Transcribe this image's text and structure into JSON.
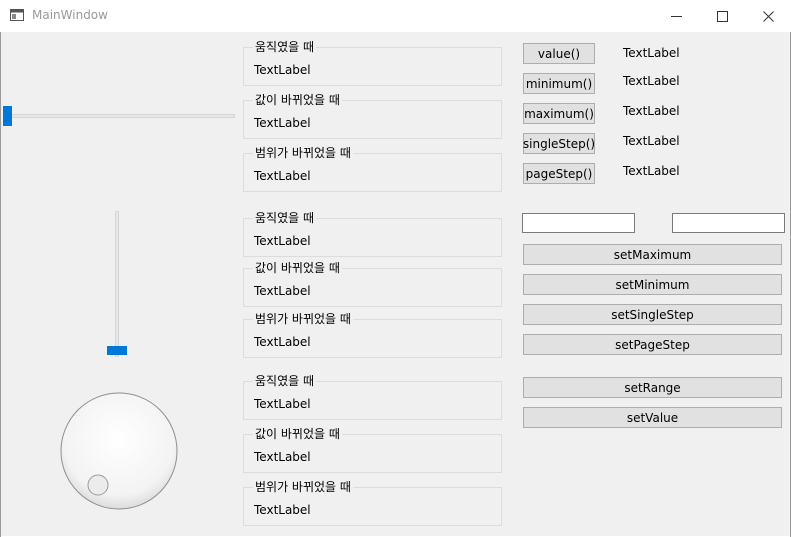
{
  "window": {
    "title": "MainWindow",
    "minimize_glyph": "—",
    "maximize_glyph": "☐",
    "close_glyph": "✕"
  },
  "slider_h": {
    "position_fraction": 0.0
  },
  "slider_v": {
    "position_fraction": 0.0
  },
  "dial": {
    "position_fraction": 0.0
  },
  "groups": [
    {
      "title": "움직였을 때",
      "label": "TextLabel"
    },
    {
      "title": "값이 바뀌었을 때",
      "label": "TextLabel"
    },
    {
      "title": "범위가 바뀌었을 때",
      "label": "TextLabel"
    },
    {
      "title": "움직였을 때",
      "label": "TextLabel"
    },
    {
      "title": "값이 바뀌었을 때",
      "label": "TextLabel"
    },
    {
      "title": "범위가 바뀌었을 때",
      "label": "TextLabel"
    },
    {
      "title": "움직였을 때",
      "label": "TextLabel"
    },
    {
      "title": "값이 바뀌었을 때",
      "label": "TextLabel"
    },
    {
      "title": "범위가 바뀌었을 때",
      "label": "TextLabel"
    }
  ],
  "status_rows": [
    {
      "button": "value()",
      "label": "TextLabel"
    },
    {
      "button": "minimum()",
      "label": "TextLabel"
    },
    {
      "button": "maximum()",
      "label": "TextLabel"
    },
    {
      "button": "singleStep()",
      "label": "TextLabel"
    },
    {
      "button": "pageStep()",
      "label": "TextLabel"
    }
  ],
  "inputs": {
    "left_value": "",
    "right_value": ""
  },
  "buttons": {
    "set_maximum": "setMaximum",
    "set_minimum": "setMinimum",
    "set_single_step": "setSingleStep",
    "set_page_step": "setPageStep",
    "set_range": "setRange",
    "set_value": "setValue"
  },
  "colors": {
    "accent": "#0078d7",
    "background": "#f0f0f0"
  }
}
